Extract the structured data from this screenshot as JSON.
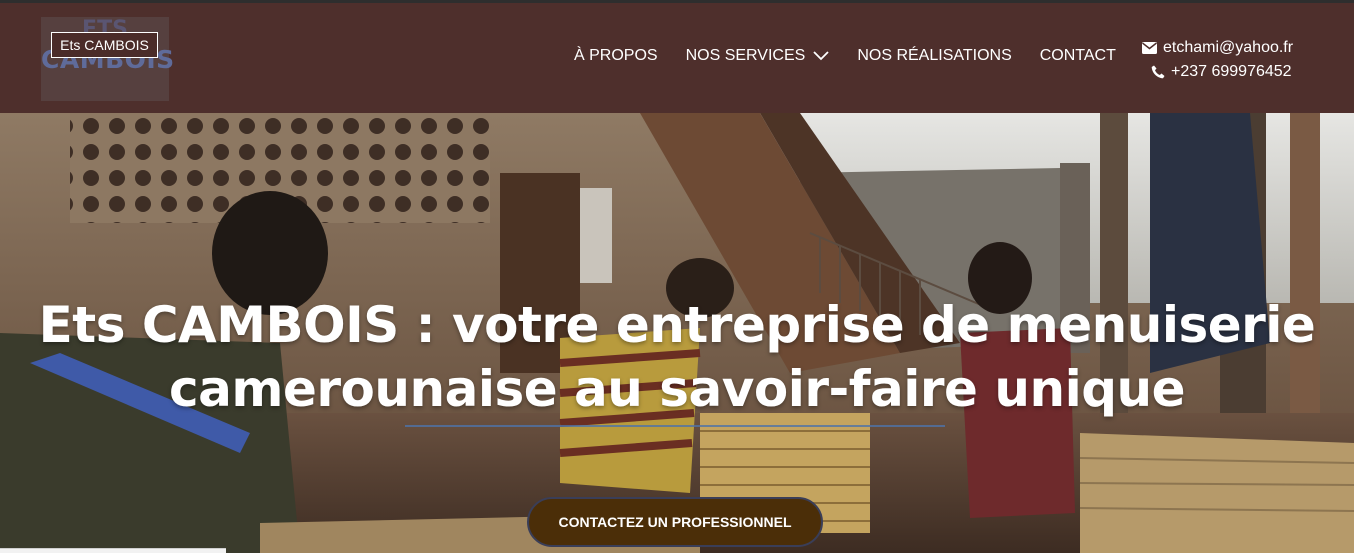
{
  "logo": {
    "label": "Ets CAMBOIS",
    "mark_top": "ETS",
    "mark_bottom": "CAMBOIS"
  },
  "nav": {
    "items": [
      {
        "label": "À PROPOS"
      },
      {
        "label": "NOS SERVICES",
        "icon": "chevron-down-icon"
      },
      {
        "label": "NOS RÉALISATIONS"
      },
      {
        "label": "CONTACT"
      }
    ]
  },
  "contact": {
    "email": "etchami@yahoo.fr",
    "email_icon": "envelope-icon",
    "phone": "+237 699976452",
    "phone_icon": "phone-icon"
  },
  "hero": {
    "title_line1": "Ets CAMBOIS : votre entreprise de menuiserie",
    "title_line2": "camerounaise au savoir-faire unique",
    "cta_label": "CONTACTEZ UN PROFESSIONNEL"
  },
  "colors": {
    "header_bg": "#4e2f2c",
    "cta_bg": "#4b2e08",
    "text": "#ffffff"
  }
}
